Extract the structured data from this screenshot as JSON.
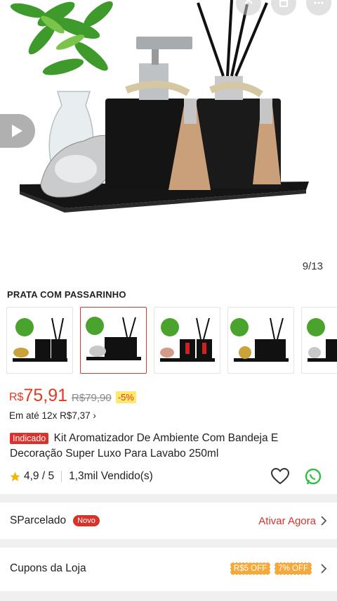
{
  "gallery": {
    "counter": "9/13"
  },
  "variant": {
    "title": "PRATA COM PASSARINHO",
    "thumbnails": [
      "thumb-1",
      "thumb-2",
      "thumb-3",
      "thumb-4",
      "thumb-5"
    ],
    "selected_index": 1
  },
  "price": {
    "currency": "R$",
    "value": "75,91",
    "old": "R$79,90",
    "discount": "-5%"
  },
  "installments": {
    "prefix": "Em até",
    "value": "12x R$7,37",
    "chevron": "›"
  },
  "product": {
    "tag": "Indicado",
    "title": "Kit Aromatizador De Ambiente Com Bandeja E Decoração Super Luxo Para Lavabo 250ml"
  },
  "rating": {
    "score": "4,9 / 5",
    "sold": "1,3mil Vendido(s)"
  },
  "sparcelado": {
    "label": "SParcelado",
    "badge": "Novo",
    "action": "Ativar Agora"
  },
  "cupons": {
    "label": "Cupons da Loja",
    "coupons": [
      "R$5 OFF",
      "7% OFF"
    ]
  },
  "colors": {
    "accent": "#d9322b",
    "price": "#e03a23",
    "coupon": "#f5a93a"
  },
  "icons": [
    "share-icon",
    "cart-icon",
    "more-icon",
    "play-icon",
    "star-icon",
    "heart-icon",
    "whatsapp-icon",
    "chevron-right-icon"
  ]
}
